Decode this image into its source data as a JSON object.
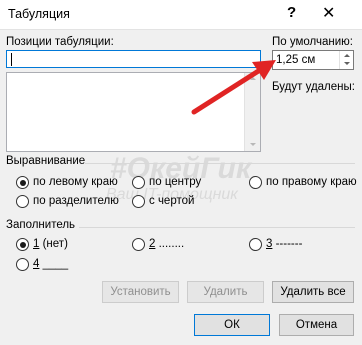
{
  "window": {
    "title": "Табуляция",
    "help_label": "?",
    "close_label": "✕"
  },
  "tab_positions": {
    "label": "Позиции табуляции:",
    "value": "",
    "list_items": []
  },
  "default_stops": {
    "label": "По умолчанию:",
    "value": "1,25 см"
  },
  "to_be_cleared": {
    "label": "Будут удалены:"
  },
  "alignment": {
    "label": "Выравнивание",
    "options": [
      {
        "label": "по левому краю",
        "checked": true
      },
      {
        "label": "по центру",
        "checked": false
      },
      {
        "label": "по правому краю",
        "checked": false
      },
      {
        "label": "по разделителю",
        "checked": false
      },
      {
        "label": "с чертой",
        "checked": false
      }
    ]
  },
  "leader": {
    "label": "Заполнитель",
    "options": [
      {
        "key": "1",
        "text": " (нет)",
        "checked": true
      },
      {
        "key": "2",
        "text": " ........",
        "checked": false
      },
      {
        "key": "3",
        "text": " -------",
        "checked": false
      },
      {
        "key": "4",
        "text": " ____",
        "checked": false
      }
    ]
  },
  "buttons": {
    "set": "Установить",
    "clear": "Удалить",
    "clear_all": "Удалить все",
    "ok": "ОК",
    "cancel": "Отмена"
  },
  "watermark": {
    "line1": "#ОкейГик",
    "line2": "Ваш IT-помощник"
  },
  "annotation": {
    "arrow_color": "#e02424"
  }
}
